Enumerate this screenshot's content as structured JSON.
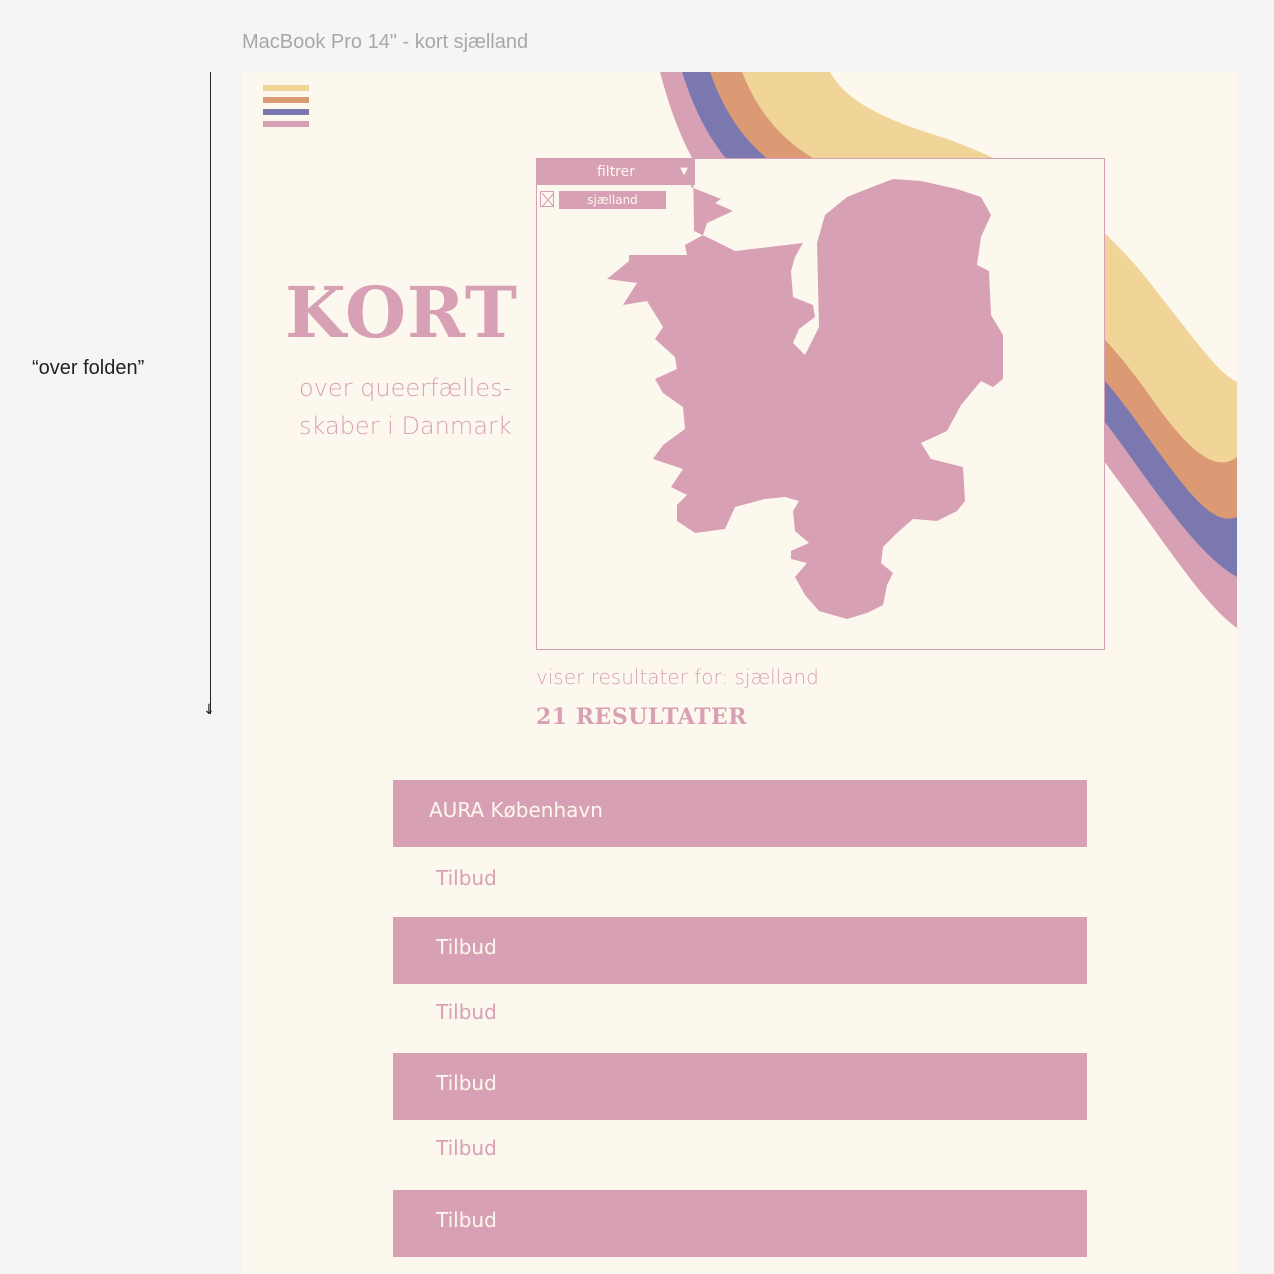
{
  "frame": {
    "title": "MacBook Pro 14\" - kort sjælland"
  },
  "annotation": {
    "fold_label": "“over folden”"
  },
  "colors": {
    "pink": "#d8a0b4",
    "purple": "#7b78b0",
    "orange": "#dc9a74",
    "yellow": "#f0d498",
    "cream": "#fdf8ee"
  },
  "menu": {
    "icon": "hamburger-menu-icon"
  },
  "hero": {
    "title": "KORT",
    "subtitle_line1": "over queerfælles-",
    "subtitle_line2": "skaber i Danmark"
  },
  "map": {
    "region": "sjælland",
    "filter": {
      "label": "filtrer",
      "chevron": "▼"
    },
    "checkbox_label": "sjælland"
  },
  "results": {
    "caption": "viser resultater for: sjælland",
    "count": "21 RESULTATER"
  },
  "list": [
    {
      "label": "AURA København",
      "style": "filled"
    },
    {
      "label": "Tilbud",
      "style": "plain"
    },
    {
      "label": "Tilbud",
      "style": "filled"
    },
    {
      "label": "Tilbud",
      "style": "plain"
    },
    {
      "label": "Tilbud",
      "style": "filled"
    },
    {
      "label": "Tilbud",
      "style": "plain"
    },
    {
      "label": "Tilbud",
      "style": "filled"
    }
  ]
}
